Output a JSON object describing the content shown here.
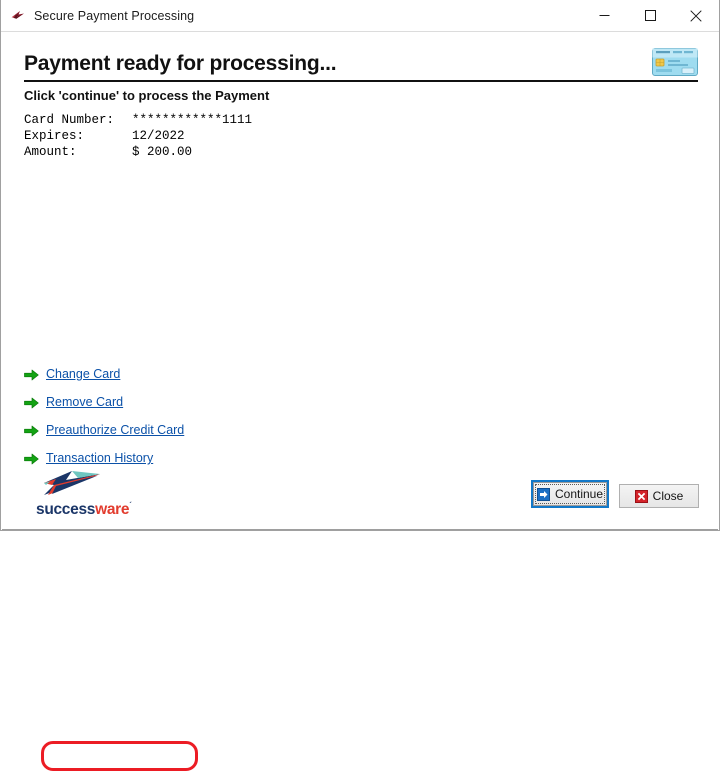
{
  "window": {
    "title": "Secure Payment Processing",
    "icon": "successware-arrow-icon",
    "controls": {
      "minimize": "minimize-icon",
      "maximize": "maximize-icon",
      "close": "close-icon"
    }
  },
  "main": {
    "heading": "Payment ready for processing...",
    "subheading": "Click 'continue' to process the Payment",
    "card_icon": "credit-card-icon",
    "details": [
      {
        "label": "Card Number:",
        "value": "************1111"
      },
      {
        "label": "Expires:",
        "value": "12/2022"
      },
      {
        "label": "Amount:",
        "value": "$ 200.00"
      }
    ],
    "links": [
      {
        "label": "Change Card",
        "icon": "green-arrow-icon",
        "highlighted": false
      },
      {
        "label": "Remove Card",
        "icon": "green-arrow-icon",
        "highlighted": false
      },
      {
        "label": "Preauthorize Credit Card",
        "icon": "green-arrow-icon",
        "highlighted": true
      },
      {
        "label": "Transaction History",
        "icon": "green-arrow-icon",
        "highlighted": false
      }
    ],
    "annotation": {
      "shape": "rounded-rect",
      "color": "#ec1c24",
      "target": "Preauthorize Credit Card"
    }
  },
  "footer": {
    "logo": {
      "mark": "successware-arrow-logo",
      "text_primary": "success",
      "text_secondary": "ware",
      "trademark": "´"
    },
    "buttons": [
      {
        "label": "Continue",
        "icon": "blue-arrow-icon",
        "focused": true
      },
      {
        "label": "Close",
        "icon": "red-x-icon",
        "focused": false
      }
    ]
  },
  "colors": {
    "link": "#0b51a8",
    "arrow_green": "#13a313",
    "annotation_red": "#ec1c24",
    "focus_blue": "#1278c8",
    "logo_navy": "#1b3668",
    "logo_red": "#e23c2e",
    "card_cyan": "#7fd4ea"
  }
}
